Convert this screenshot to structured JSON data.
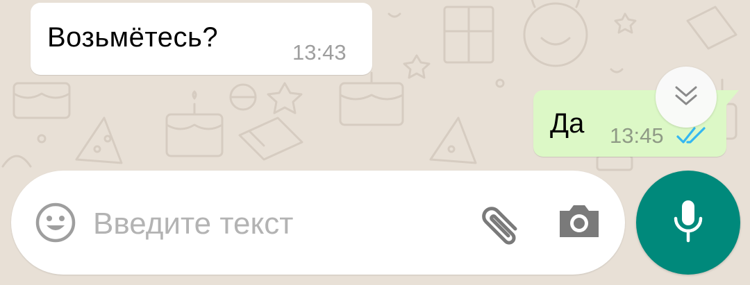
{
  "chat": {
    "messages": [
      {
        "direction": "incoming",
        "text": "Возьмётесь?",
        "time": "13:43"
      },
      {
        "direction": "outgoing",
        "text": "Да",
        "time": "13:45",
        "status": "read"
      }
    ]
  },
  "composer": {
    "placeholder": "Введите текст",
    "icons": {
      "emoji": "smiley-icon",
      "attach": "paperclip-icon",
      "camera": "camera-icon",
      "mic": "microphone-icon",
      "scroll": "double-chevron-down-icon"
    }
  },
  "colors": {
    "background": "#e8e0d6",
    "incoming_bubble": "#ffffff",
    "outgoing_bubble": "#dcf8c6",
    "read_ticks": "#34b7f1",
    "mic_button": "#00897b",
    "placeholder": "#b3b3b3"
  }
}
